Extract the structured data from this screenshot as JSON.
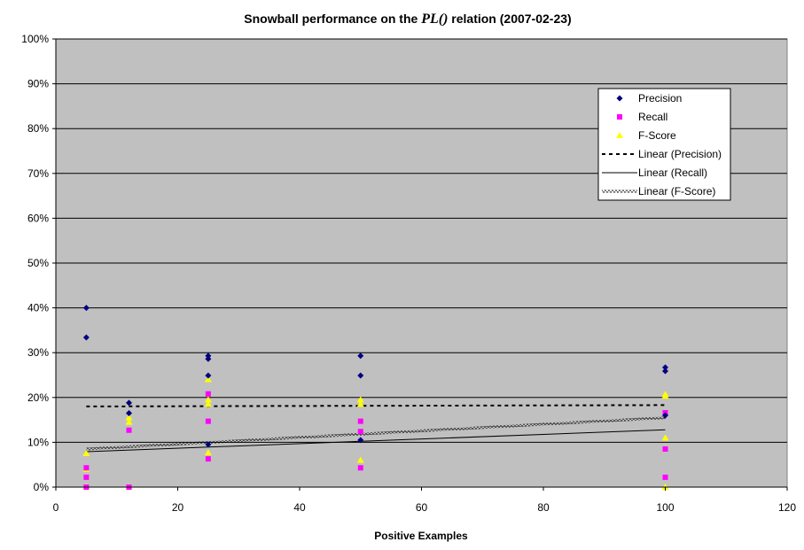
{
  "chart_data": {
    "type": "scatter",
    "title_prefix": "Snowball performance on the ",
    "title_relation": "PL()",
    "title_suffix": " relation (2007-02-23)",
    "xlabel": "Positive Examples",
    "ylabel": "",
    "xlim": [
      0,
      120
    ],
    "ylim": [
      0,
      1
    ],
    "x_ticks": [
      0,
      20,
      40,
      60,
      80,
      100,
      120
    ],
    "y_ticks": [
      0,
      0.1,
      0.2,
      0.3,
      0.4,
      0.5,
      0.6,
      0.7,
      0.8,
      0.9,
      1.0
    ],
    "y_tick_labels": [
      "0%",
      "10%",
      "20%",
      "30%",
      "40%",
      "50%",
      "60%",
      "70%",
      "80%",
      "90%",
      "100%"
    ],
    "grid": "horizontal",
    "legend_position": "top-right",
    "series": [
      {
        "name": "Precision",
        "marker": "diamond",
        "color": "#000080",
        "points": [
          [
            5,
            0.4
          ],
          [
            5,
            0.334
          ],
          [
            12,
            0.188
          ],
          [
            12,
            0.165
          ],
          [
            25,
            0.293
          ],
          [
            25,
            0.286
          ],
          [
            25,
            0.249
          ],
          [
            25,
            0.095
          ],
          [
            50,
            0.293
          ],
          [
            50,
            0.249
          ],
          [
            50,
            0.105
          ],
          [
            100,
            0.267
          ],
          [
            100,
            0.259
          ],
          [
            100,
            0.16
          ]
        ]
      },
      {
        "name": "Recall",
        "marker": "square",
        "color": "#ff00ff",
        "points": [
          [
            5,
            0.043
          ],
          [
            5,
            0.022
          ],
          [
            5,
            0.0
          ],
          [
            12,
            0.127
          ],
          [
            12,
            0.0
          ],
          [
            25,
            0.208
          ],
          [
            25,
            0.147
          ],
          [
            25,
            0.063
          ],
          [
            50,
            0.147
          ],
          [
            50,
            0.124
          ],
          [
            50,
            0.043
          ],
          [
            100,
            0.166
          ],
          [
            100,
            0.085
          ],
          [
            100,
            0.022
          ]
        ]
      },
      {
        "name": "F-Score",
        "marker": "triangle",
        "color": "#ffff00",
        "points": [
          [
            5,
            0.075
          ],
          [
            5,
            0.04
          ],
          [
            5,
            0.0
          ],
          [
            12,
            0.155
          ],
          [
            12,
            0.145
          ],
          [
            12,
            0.0
          ],
          [
            25,
            0.24
          ],
          [
            25,
            0.195
          ],
          [
            25,
            0.185
          ],
          [
            25,
            0.077
          ],
          [
            50,
            0.195
          ],
          [
            50,
            0.185
          ],
          [
            50,
            0.06
          ],
          [
            100,
            0.207
          ],
          [
            100,
            0.203
          ],
          [
            100,
            0.11
          ],
          [
            100,
            0.0
          ]
        ]
      },
      {
        "name": "Linear (Precision)",
        "style": "dashed",
        "color": "#000000",
        "line": [
          [
            5,
            0.18
          ],
          [
            100,
            0.183
          ]
        ]
      },
      {
        "name": "Linear (Recall)",
        "style": "solid",
        "color": "#000000",
        "line": [
          [
            5,
            0.079
          ],
          [
            100,
            0.128
          ]
        ]
      },
      {
        "name": "Linear (F-Score)",
        "style": "wavy",
        "color": "#000000",
        "line": [
          [
            5,
            0.085
          ],
          [
            100,
            0.155
          ]
        ]
      }
    ],
    "colors": {
      "plot_background": "#c0c0c0",
      "gridline": "#000000"
    }
  }
}
